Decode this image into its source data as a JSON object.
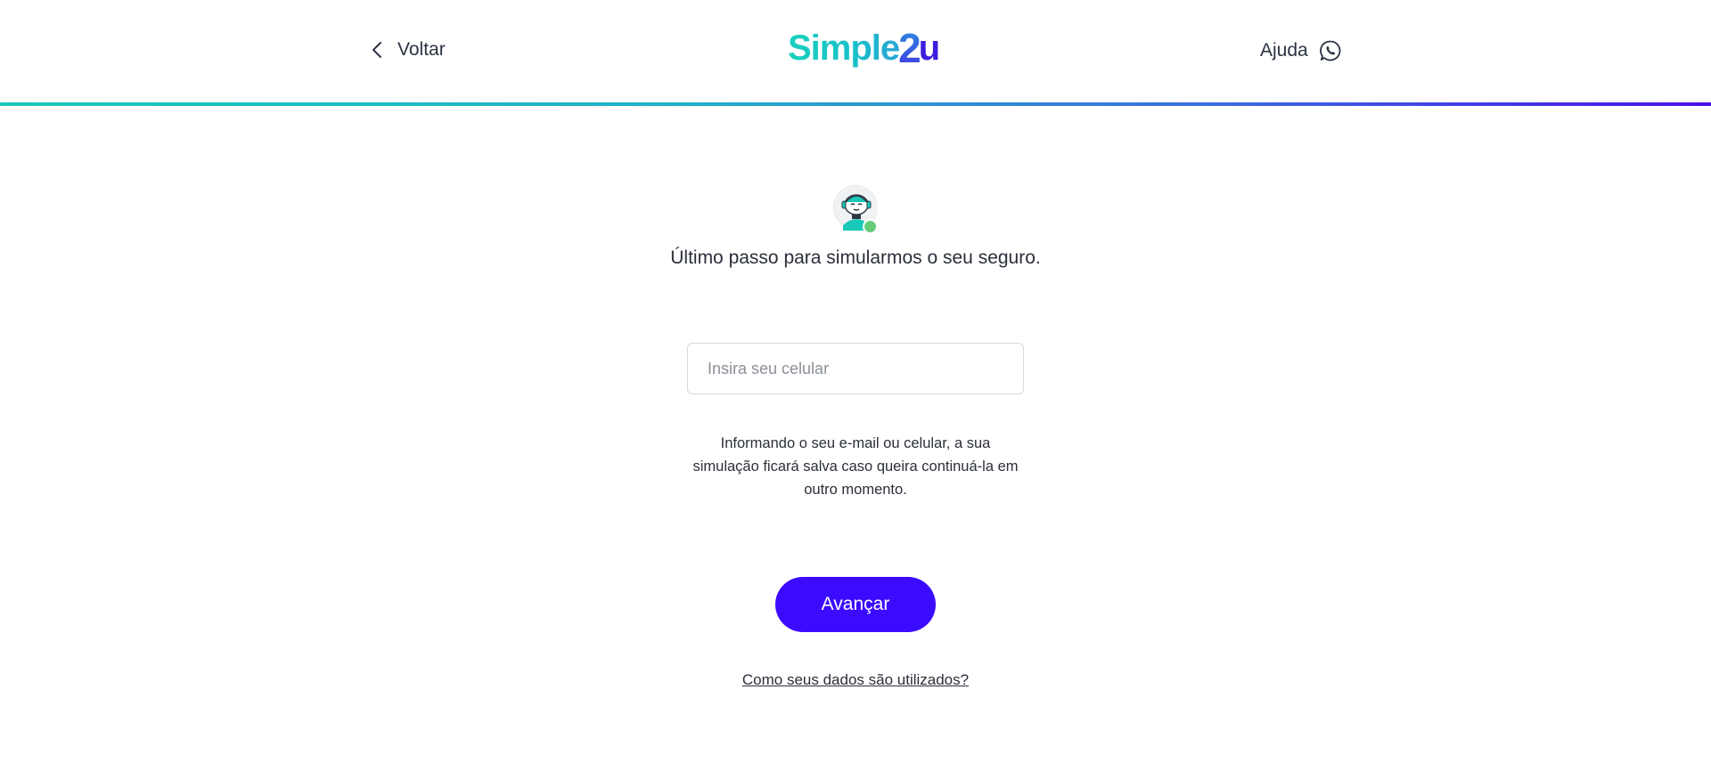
{
  "header": {
    "back_label": "Voltar",
    "logo": {
      "main": "Simple",
      "two": "2",
      "u": "u"
    },
    "help_label": "Ajuda",
    "icons": {
      "back": "chevron-left-icon",
      "help": "whatsapp-icon"
    },
    "gradient_colors": [
      "#19c9b8",
      "#4a12e8"
    ]
  },
  "main": {
    "avatar_icon": "robot-assistant-avatar",
    "online_status_color": "#66cc7a",
    "title": "Último passo para simularmos o seu seguro.",
    "phone_input": {
      "value": "",
      "placeholder": "Insira seu celular"
    },
    "info_text": "Informando o seu e-mail ou celular, a sua simulação ficará salva caso queira continuá-la em outro momento.",
    "advance_label": "Avançar",
    "advance_color": "#3a0bff",
    "data_link": "Como seus dados são utilizados?"
  }
}
